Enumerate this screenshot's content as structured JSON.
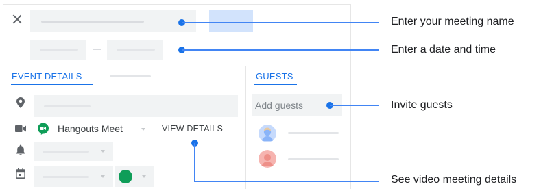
{
  "editor": {
    "tabs": [
      {
        "label": "EVENT DETAILS",
        "active": true
      },
      {
        "label": "",
        "active": false
      }
    ],
    "guests_tab": {
      "label": "GUESTS",
      "active": true
    },
    "conference": {
      "provider_label": "Hangouts Meet",
      "view_details_label": "VIEW DETAILS"
    },
    "guests": {
      "placeholder": "Add guests"
    },
    "event_color": "#0f9d58",
    "accent_color": "#1a73e8"
  },
  "callouts": [
    {
      "text": "Enter your meeting name"
    },
    {
      "text": "Enter a date and time"
    },
    {
      "text": "Invite guests"
    },
    {
      "text": "See video meeting details"
    }
  ],
  "icons": [
    "close-icon",
    "location-pin-icon",
    "video-camera-icon",
    "hangouts-meet-icon",
    "bell-icon",
    "calendar-icon",
    "chevron-down-icon"
  ]
}
